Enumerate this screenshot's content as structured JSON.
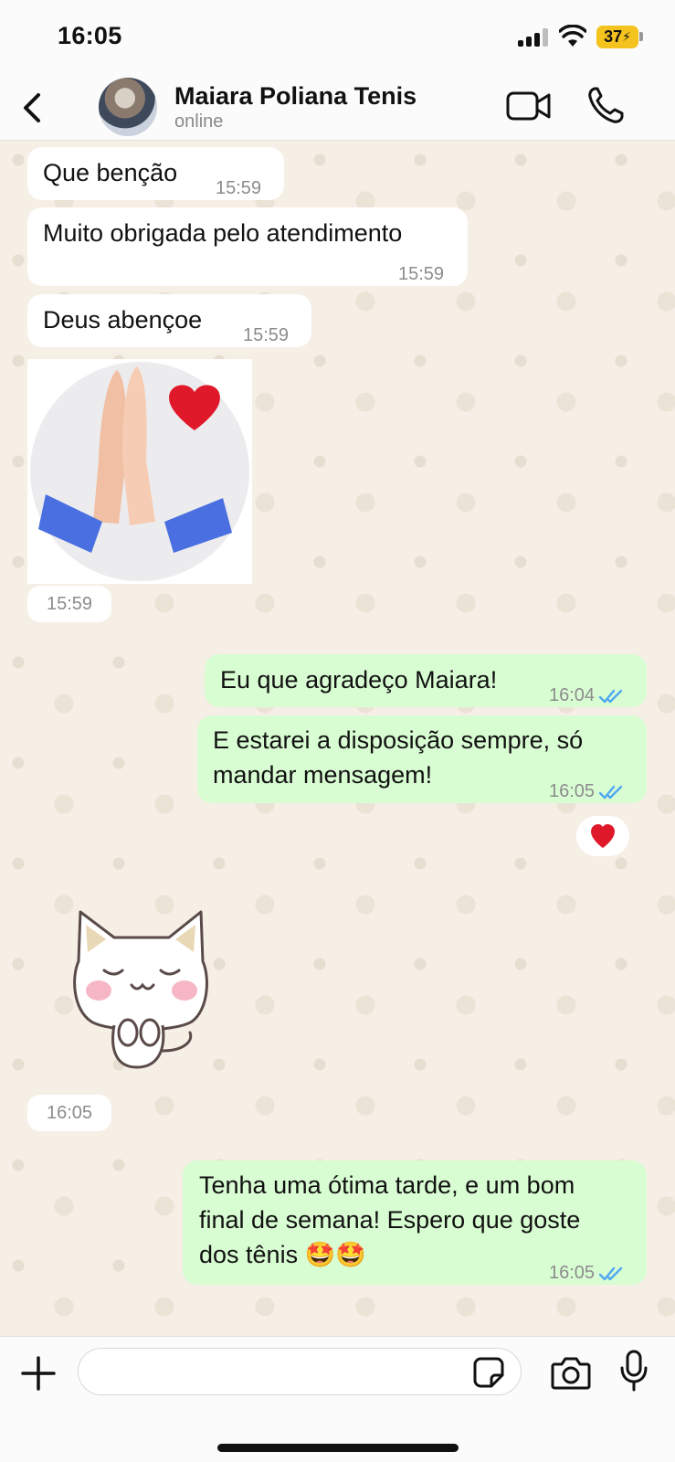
{
  "status_bar": {
    "time": "16:05",
    "battery": "37"
  },
  "header": {
    "contact_name": "Maiara Poliana Tenis",
    "contact_status": "online"
  },
  "messages": [
    {
      "direction": "in",
      "text": "Que benção",
      "time": "15:59"
    },
    {
      "direction": "in",
      "text": "Muito obrigada pelo atendimento",
      "time": "15:59"
    },
    {
      "direction": "in",
      "text": "Deus abençoe",
      "time": "15:59"
    },
    {
      "direction": "in",
      "type": "sticker",
      "sticker": "praying-hands-heart",
      "time": "15:59"
    },
    {
      "direction": "out",
      "text": "Eu que agradeço Maiara!",
      "time": "16:04",
      "status": "read"
    },
    {
      "direction": "out",
      "text_line1": "E estarei a disposição sempre, só",
      "text_line2": "mandar mensagem!",
      "time": "16:05",
      "status": "read",
      "reaction": "❤️"
    },
    {
      "direction": "in",
      "type": "sticker",
      "sticker": "white-cat",
      "time": "16:05"
    },
    {
      "direction": "out",
      "text_line1": "Tenha uma ótima tarde, e um bom",
      "text_line2": "final de semana! Espero que goste",
      "text_line3": "dos tênis 🤩🤩",
      "time": "16:05",
      "status": "read"
    }
  ],
  "input": {
    "value": "",
    "placeholder": ""
  },
  "icons": {
    "back": "chevron-left-icon",
    "video": "video-camera-icon",
    "call": "phone-icon",
    "attach": "plus-icon",
    "sticker": "sticker-icon",
    "camera": "camera-icon",
    "mic": "microphone-icon"
  },
  "colors": {
    "outgoing_bubble": "#d9fdd3",
    "incoming_bubble": "#ffffff",
    "read_ticks": "#4fa8f0",
    "reaction": "#e0192a"
  }
}
